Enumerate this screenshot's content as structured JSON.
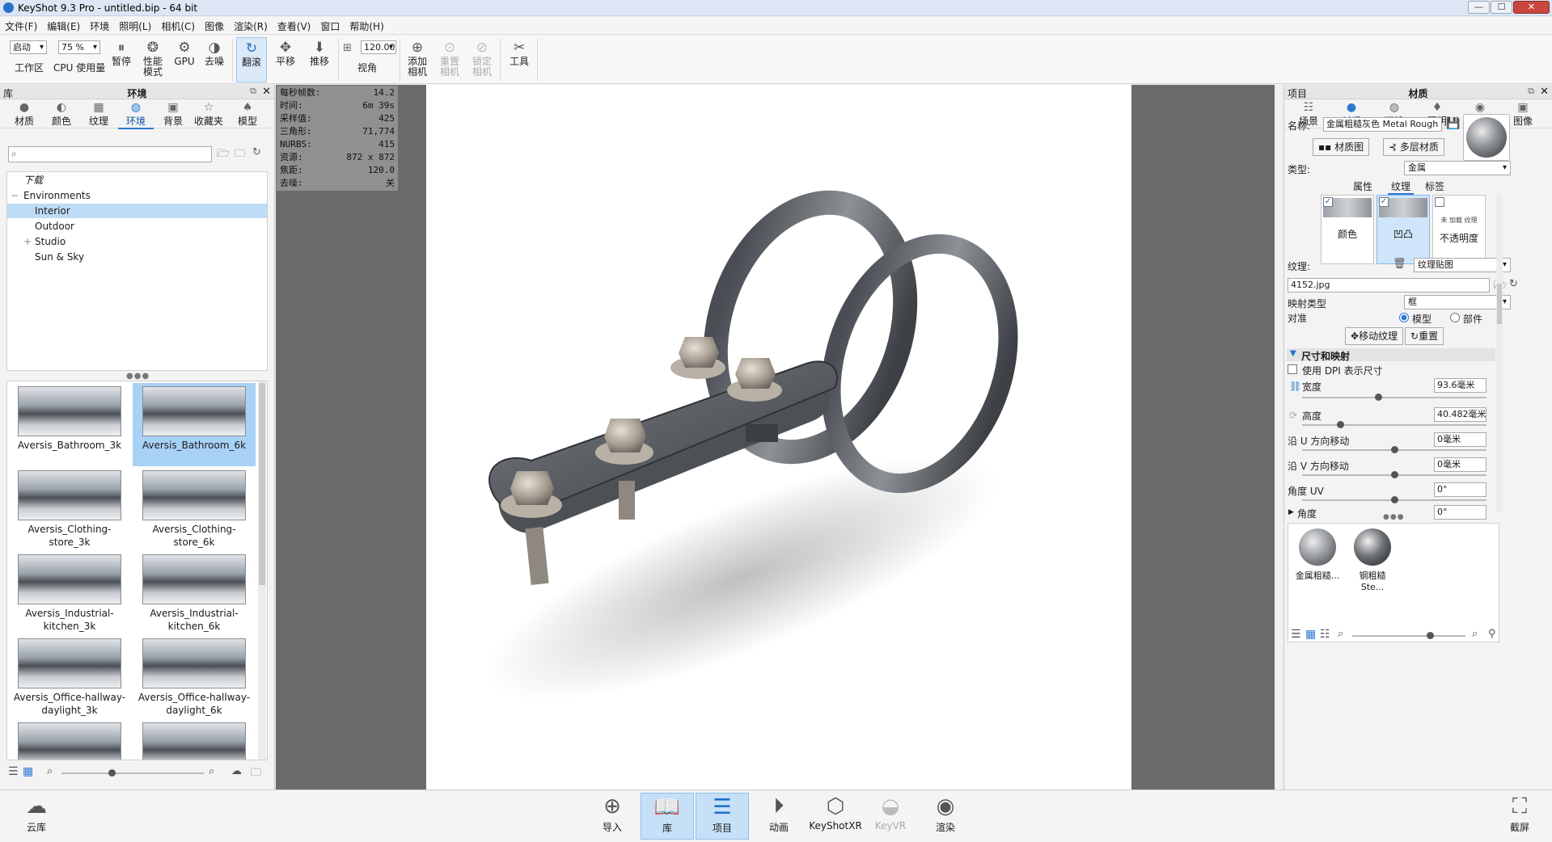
{
  "window": {
    "title": "KeyShot 9.3 Pro  - untitled.bip  - 64 bit",
    "min": "—",
    "max": "☐",
    "close": "✕"
  },
  "menu": [
    "文件(F)",
    "编辑(E)",
    "环境",
    "照明(L)",
    "相机(C)",
    "图像",
    "渲染(R)",
    "查看(V)",
    "窗口",
    "帮助(H)"
  ],
  "toolbar": {
    "workspace_select": "启动",
    "workspace_label": "工作区",
    "cpu_select": "75 %",
    "cpu_label": "CPU 使用量",
    "pause": "暂停",
    "perf_mode_l1": "性能",
    "perf_mode_l2": "模式",
    "gpu": "GPU",
    "denoise": "去噪",
    "tumble": "翻滚",
    "pan": "平移",
    "dolly": "推移",
    "fov_value": "120.00",
    "fov_label": "视角",
    "add_cam_l1": "添加",
    "add_cam_l2": "相机",
    "reset_cam_l1": "重置",
    "reset_cam_l2": "相机",
    "lock_cam_l1": "锁定",
    "lock_cam_l2": "相机",
    "tools": "工具"
  },
  "library": {
    "header_left": "库",
    "header_title": "环境",
    "tabs": [
      "材质",
      "颜色",
      "纹理",
      "环境",
      "背景",
      "收藏夹",
      "模型"
    ],
    "search_placeholder": "",
    "tree": [
      {
        "label": "下载",
        "italic": true,
        "indent": 0
      },
      {
        "label": "Environments",
        "indent": 0,
        "toggle": "−"
      },
      {
        "label": "Interior",
        "indent": 1,
        "selected": true
      },
      {
        "label": "Outdoor",
        "indent": 1
      },
      {
        "label": "Studio",
        "indent": 1,
        "toggle": "+"
      },
      {
        "label": "Sun & Sky",
        "indent": 1
      }
    ],
    "thumbnails": [
      {
        "l1": "Aversis_Bathroom_3k",
        "l2": ""
      },
      {
        "l1": "Aversis_Bathroom_6k",
        "l2": "",
        "selected": true
      },
      {
        "l1": "Aversis_Clothing-",
        "l2": "store_3k"
      },
      {
        "l1": "Aversis_Clothing-",
        "l2": "store_6k"
      },
      {
        "l1": "Aversis_Industrial-",
        "l2": "kitchen_3k"
      },
      {
        "l1": "Aversis_Industrial-",
        "l2": "kitchen_6k"
      },
      {
        "l1": "Aversis_Office-hallway-",
        "l2": "daylight_3k"
      },
      {
        "l1": "Aversis_Office-hallway-",
        "l2": "daylight_6k"
      },
      {
        "l1": "",
        "l2": ""
      },
      {
        "l1": "",
        "l2": ""
      }
    ]
  },
  "hud": [
    [
      "每秒帧数:",
      "14.2"
    ],
    [
      "时间:",
      "6m 39s"
    ],
    [
      "采样值:",
      "425"
    ],
    [
      "三角形:",
      "71,774"
    ],
    [
      "NURBS:",
      "415"
    ],
    [
      "资源:",
      "872 x 872"
    ],
    [
      "焦距:",
      "120.0"
    ],
    [
      "去噪:",
      "关"
    ]
  ],
  "project": {
    "header_left": "项目",
    "header_title": "材质",
    "tabs": [
      "场景",
      "材质",
      "环境",
      "照明",
      "相机",
      "图像"
    ],
    "name_label": "名称:",
    "name_value": "金属粗糙灰色 Metal Rough Grey",
    "btn_graph": "材质图",
    "btn_multi": "多层材质",
    "type_label": "类型:",
    "type_value": "金属",
    "subtabs": [
      "属性",
      "纹理",
      "标签"
    ],
    "swatches": [
      {
        "label": "颜色",
        "checked": true
      },
      {
        "label": "凹凸",
        "checked": true,
        "on": true
      },
      {
        "label": "不透明度",
        "checked": false,
        "note": "未 加载 纹理"
      }
    ],
    "texture_label": "纹理:",
    "texture_value": "纹理贴图",
    "file_value": "4152.jpg",
    "mapping_label": "映射类型",
    "mapping_value": "框",
    "align_label": "对准",
    "align_opt1": "模型",
    "align_opt2": "部件",
    "btn_move": "移动纹理",
    "btn_reset": "重置",
    "section_size": "尺寸和映射",
    "dpi_label": "使用 DPI 表示尺寸",
    "width_label": "宽度",
    "width_value": "93.6毫米",
    "height_label": "高度",
    "height_value": "40.482毫米",
    "u_label": "沿 U 方向移动",
    "u_value": "0毫米",
    "v_label": "沿 V 方向移动",
    "v_value": "0毫米",
    "angle_uv_label": "角度 UV",
    "angle_uv_value": "0°",
    "angle_label": "角度",
    "angle_value": "0°",
    "materials": [
      "金属粗糙...",
      "钢粗糙 Ste..."
    ]
  },
  "bottom": {
    "cloud": "云库",
    "import": "导入",
    "library": "库",
    "project": "项目",
    "animation": "动画",
    "keyshotxr": "KeyShotXR",
    "keyvr": "KeyVR",
    "render": "渲染",
    "screenshot": "截屏"
  },
  "colors": {
    "accent": "#2a7ad5",
    "viewport_bg": "#6b6b6b",
    "selection": "#bfdcf7"
  }
}
